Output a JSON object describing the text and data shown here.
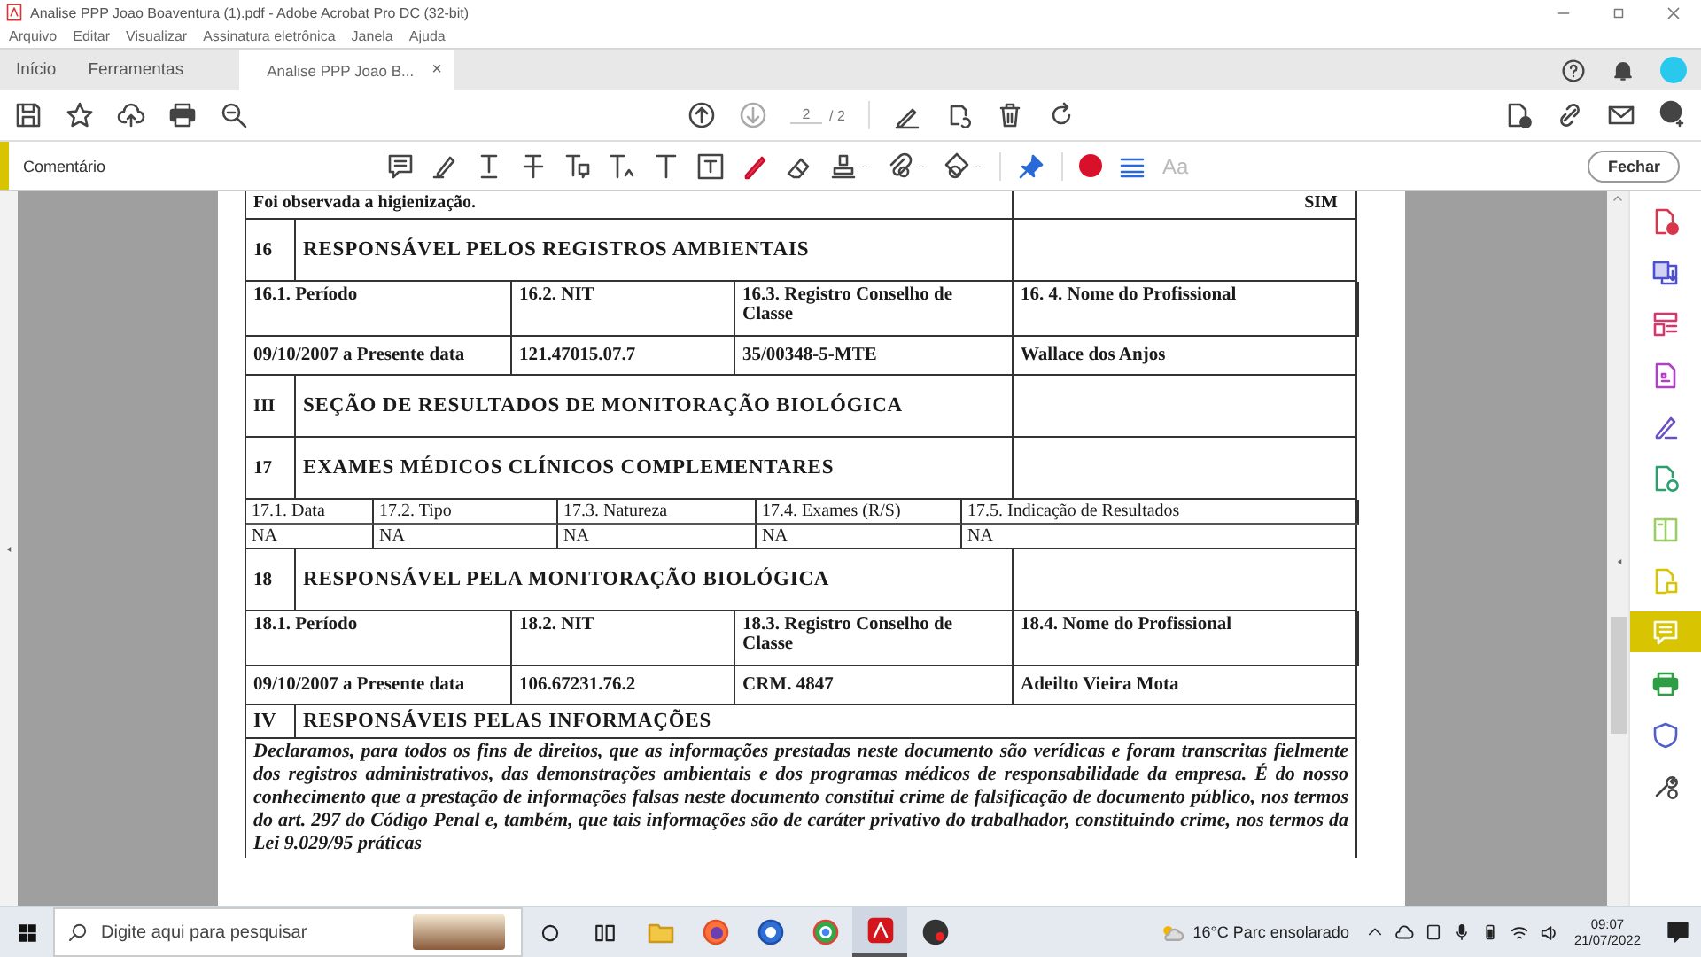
{
  "window": {
    "title": "Analise PPP Joao Boaventura (1).pdf - Adobe Acrobat Pro DC (32-bit)"
  },
  "menu": [
    "Arquivo",
    "Editar",
    "Visualizar",
    "Assinatura eletrônica",
    "Janela",
    "Ajuda"
  ],
  "tabs": [
    {
      "label": "Início",
      "selected": false
    },
    {
      "label": "Ferramentas",
      "selected": false
    },
    {
      "label": "Analise PPP Joao B...",
      "selected": true,
      "close": "×"
    }
  ],
  "page_nav": {
    "current": "2",
    "total": "/ 2"
  },
  "comment_bar": {
    "title": "Comentário",
    "font_label": "Aa",
    "close_button": "Fechar"
  },
  "document": {
    "rows": [
      {
        "kind": "note",
        "text": "Foi observada a higienização.",
        "value": "SIM"
      },
      {
        "kind": "section",
        "number": "16",
        "title": "RESPONSÁVEL PELOS REGISTROS AMBIENTAIS"
      },
      {
        "kind": "fields",
        "cells": [
          {
            "label": "16.1. Período",
            "value": "09/10/2007 a Presente data"
          },
          {
            "label": "16.2. NIT",
            "value": "121.47015.07.7"
          },
          {
            "label": "16.3. Registro Conselho de Classe",
            "value": "35/00348-5-MTE"
          },
          {
            "label": "16. 4. Nome do Profissional",
            "value": "Wallace dos Anjos"
          }
        ]
      },
      {
        "kind": "section",
        "number": "III",
        "title": "SEÇÃO DE RESULTADOS DE MONITORAÇÃO BIOLÓGICA"
      },
      {
        "kind": "section",
        "number": "17",
        "title": "EXAMES MÉDICOS CLÍNICOS COMPLEMENTARES"
      },
      {
        "kind": "compact",
        "cells": [
          {
            "label": "17.1. Data",
            "value": "NA"
          },
          {
            "label": "17.2. Tipo",
            "value": "NA"
          },
          {
            "label": "17.3. Natureza",
            "value": "NA"
          },
          {
            "label": "17.4. Exames (R/S)",
            "value": "NA"
          },
          {
            "label": "17.5. Indicação de Resultados",
            "value": "NA"
          }
        ]
      },
      {
        "kind": "section",
        "number": "18",
        "title": "RESPONSÁVEL PELA MONITORAÇÃO BIOLÓGICA"
      },
      {
        "kind": "fields",
        "cells": [
          {
            "label": "18.1. Período",
            "value": "09/10/2007 a Presente data"
          },
          {
            "label": "18.2. NIT",
            "value": "106.67231.76.2"
          },
          {
            "label": "18.3. Registro Conselho de Classe",
            "value": "CRM. 4847"
          },
          {
            "label": "18.4. Nome do Profissional",
            "value": "Adeilto Vieira Mota"
          }
        ]
      },
      {
        "kind": "heading",
        "number": "IV",
        "title": "RESPONSÁVEIS PELAS INFORMAÇÕES"
      },
      {
        "kind": "paragraph",
        "text": "Declaramos, para todos os fins de direitos, que as informações prestadas neste documento são verídicas e foram transcritas fielmente dos registros administrativos, das demonstrações ambientais e dos programas médicos de responsabilidade da empresa. É do nosso conhecimento que a prestação de informações falsas neste documento constitui crime de falsificação de documento público, nos termos do art. 297 do Código Penal e, também, que tais informações são de caráter privativo do trabalhador, constituindo crime, nos termos da Lei 9.029/95 práticas"
      }
    ]
  },
  "tool_panel": [
    {
      "selected": false
    },
    {
      "selected": false
    },
    {
      "selected": false
    },
    {
      "selected": false
    },
    {
      "selected": false
    },
    {
      "selected": false
    },
    {
      "selected": false
    },
    {
      "selected": false
    },
    {
      "selected": true
    },
    {
      "selected": false
    },
    {
      "selected": false
    },
    {
      "selected": false
    }
  ],
  "taskbar": {
    "search_placeholder": "Digite aqui para pesquisar",
    "apps": [
      {
        "selected": false
      },
      {
        "selected": false
      },
      {
        "selected": false
      },
      {
        "selected": false
      },
      {
        "selected": true
      },
      {
        "selected": false
      }
    ],
    "weather": "16°C Parc ensolarado",
    "time": "09:07",
    "date": "21/07/2022"
  }
}
